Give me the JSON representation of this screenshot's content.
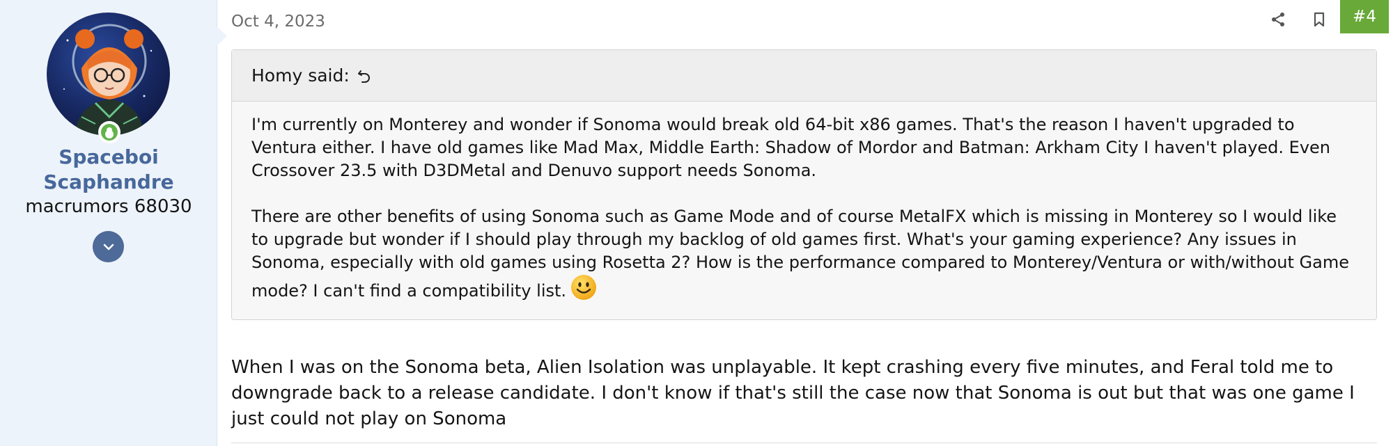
{
  "user": {
    "name": "Spaceboi Scaphandre",
    "name_line1": "Spaceboi",
    "name_line2": "Scaphandre",
    "title": "macrumors 68030",
    "online": true
  },
  "post": {
    "date": "Oct 4, 2023",
    "number": "#4",
    "actions": [
      "share-icon",
      "bookmark-icon"
    ]
  },
  "quote": {
    "author_label": "Homy said:",
    "paragraph1": "I'm currently on Monterey and wonder if Sonoma would break old 64-bit x86 games. That's the reason I haven't upgraded to Ventura either. I have old games like Mad Max, Middle Earth: Shadow of Mordor and Batman: Arkham City I haven't played. Even Crossover 23.5 with D3DMetal and Denuvo support needs Sonoma.",
    "paragraph2": "There are other benefits of using Sonoma such as Game Mode and of course MetalFX which is missing in Monterey so I would like to upgrade but wonder if I should play through my backlog of old games first. What's your gaming experience? Any issues in Sonoma, especially with old games using Rosetta 2? How is the performance compared to Monterey/Ventura or with/without Game mode? I can't find a compatibility list.",
    "emoji": "smiley-emoji"
  },
  "body": {
    "text": "When I was on the Sonoma beta, Alien Isolation was unplayable. It kept crashing every five minutes, and Feral told me to downgrade back to a release candidate. I don't know if that's still the case now that Sonoma is out but that was one game I just could not play on Sonoma"
  },
  "colors": {
    "sidebar_bg": "#edf3fa",
    "username": "#47689b",
    "post_number_bg": "#69a939",
    "online": "#63b34a"
  }
}
